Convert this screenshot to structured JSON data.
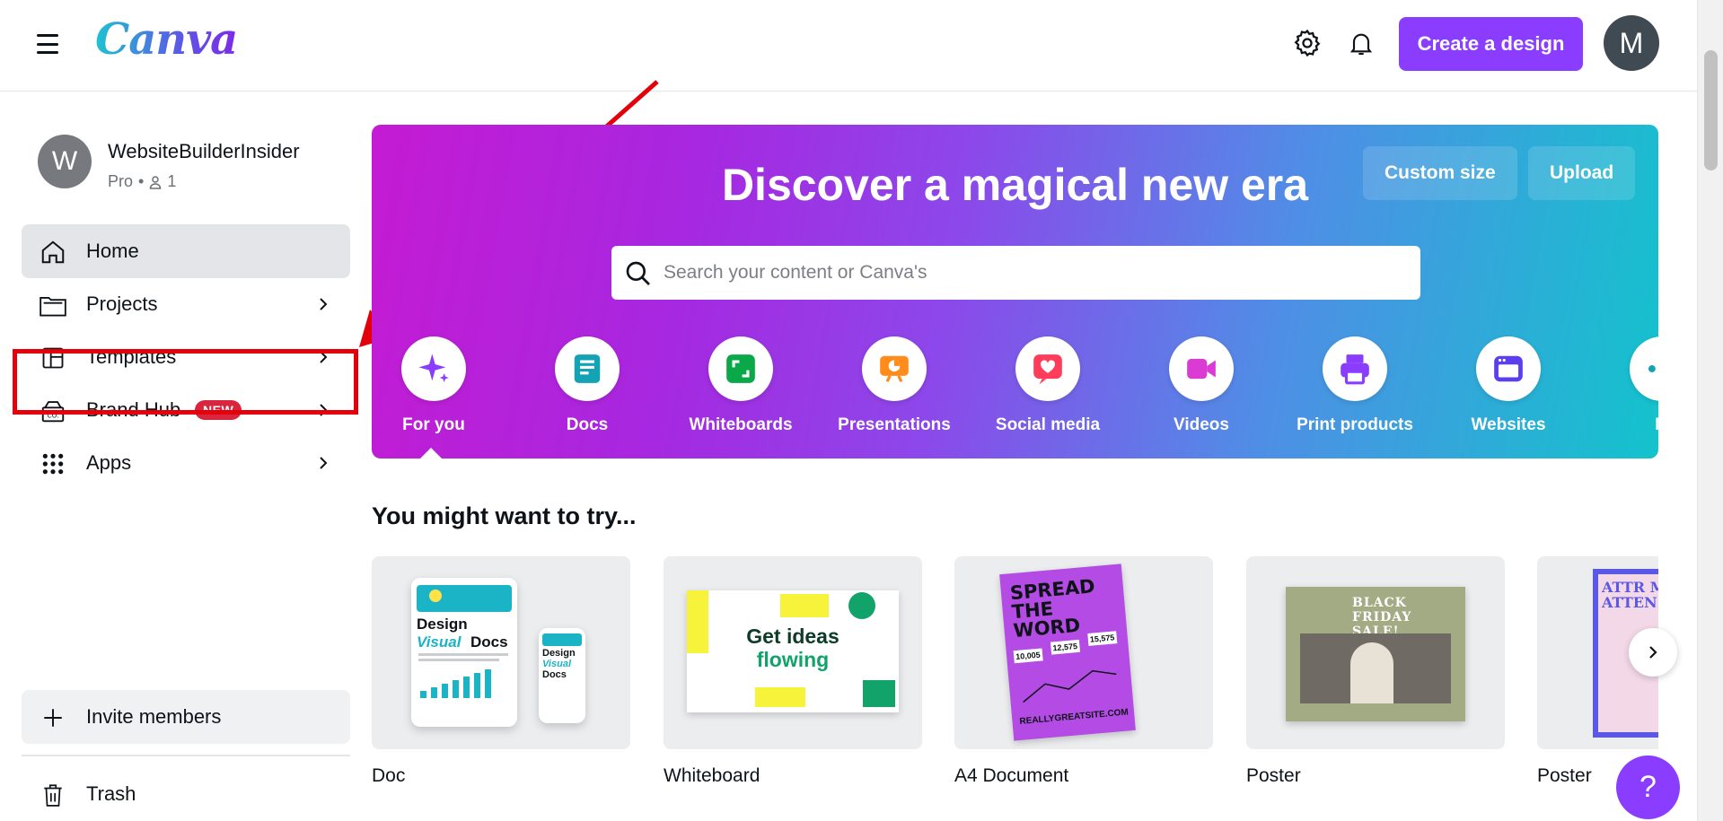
{
  "app": {
    "logo": "Canva",
    "primary_color": "#8b3dff"
  },
  "header": {
    "create_button": "Create a design",
    "account_initial": "M",
    "icons": [
      "menu-icon",
      "settings-icon",
      "notifications-icon"
    ]
  },
  "sidebar": {
    "team": {
      "initial": "W",
      "name": "WebsiteBuilderInsider",
      "plan": "Pro",
      "separator": "•",
      "members": "1"
    },
    "items": [
      {
        "label": "Home",
        "icon": "home-icon",
        "active": true
      },
      {
        "label": "Projects",
        "icon": "folder-icon"
      },
      {
        "label": "Templates",
        "icon": "templates-icon"
      },
      {
        "label": "Brand Hub",
        "icon": "brand-hub-icon",
        "badge": "NEW"
      },
      {
        "label": "Apps",
        "icon": "apps-grid-icon"
      }
    ],
    "invite": "Invite members",
    "trash": "Trash"
  },
  "banner": {
    "title": "Discover a magical new era",
    "custom_size": "Custom size",
    "upload": "Upload",
    "search_placeholder": "Search your content or Canva's",
    "categories": [
      {
        "label": "For you",
        "icon": "sparkle-icon",
        "color": "#8b3dff"
      },
      {
        "label": "Docs",
        "icon": "docs-icon",
        "color": "#13a3b5"
      },
      {
        "label": "Whiteboards",
        "icon": "whiteboard-icon",
        "color": "#0ba84a"
      },
      {
        "label": "Presentations",
        "icon": "presentation-icon",
        "color": "#ff8c1a"
      },
      {
        "label": "Social media",
        "icon": "heart-icon",
        "color": "#ff3d5a"
      },
      {
        "label": "Videos",
        "icon": "video-icon",
        "color": "#d93bd3"
      },
      {
        "label": "Print products",
        "icon": "printer-icon",
        "color": "#8b3dff"
      },
      {
        "label": "Websites",
        "icon": "website-icon",
        "color": "#5b3ef0"
      },
      {
        "label": "M",
        "icon": "more-icon",
        "color": "#13a3b5"
      }
    ]
  },
  "try_section": {
    "title": "You might want to try...",
    "cards": [
      {
        "label": "Doc",
        "art": {
          "big_title": "Design",
          "big_title2": "Visual",
          "big_title3": "Docs"
        }
      },
      {
        "label": "Whiteboard",
        "art": {
          "text1": "Get ideas",
          "text2": "flowing"
        }
      },
      {
        "label": "A4 Document",
        "art": {
          "title": "SPREAD THE WORD",
          "nums": [
            "10,005",
            "12,575",
            "15,575"
          ],
          "footer": "REALLYGREATSITE.COM"
        }
      },
      {
        "label": "Poster",
        "art": {
          "title": "BLACK FRIDAY SALE!"
        }
      },
      {
        "label": "Poster",
        "art": {
          "title": "ATTR MO ATTEN"
        }
      }
    ]
  },
  "help": "?"
}
